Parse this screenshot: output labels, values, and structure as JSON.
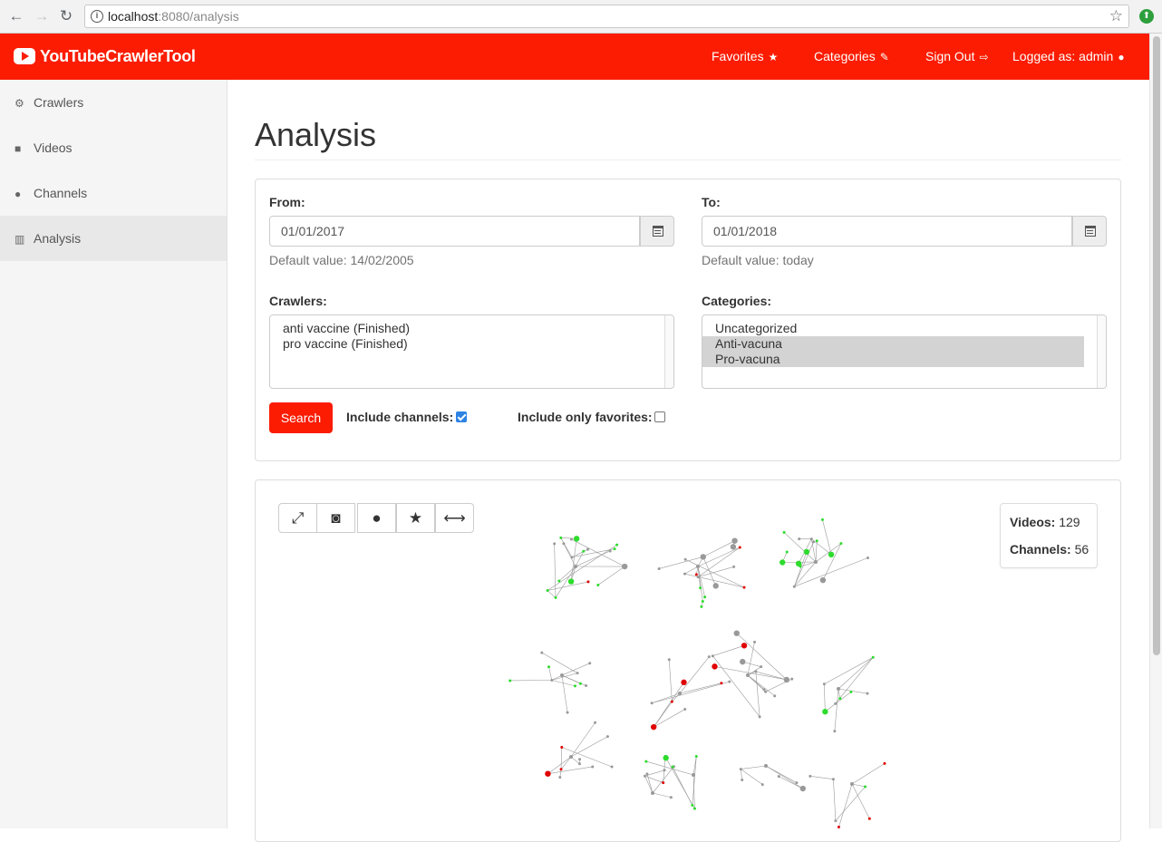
{
  "browser": {
    "url_host": "localhost",
    "url_rest": ":8080/analysis"
  },
  "navbar": {
    "brand": "YouTubeCrawlerTool",
    "links": [
      {
        "label": "Favorites",
        "icon": "star-icon"
      },
      {
        "label": "Categories",
        "icon": "edit-icon"
      },
      {
        "label": "Sign Out",
        "icon": "sign-out-icon"
      },
      {
        "label": "Logged as: admin",
        "icon": "user-icon"
      }
    ]
  },
  "sidebar": {
    "items": [
      {
        "label": "Crawlers",
        "icon": "gears-icon"
      },
      {
        "label": "Videos",
        "icon": "video-camera-icon"
      },
      {
        "label": "Channels",
        "icon": "users-icon"
      },
      {
        "label": "Analysis",
        "icon": "bar-chart-icon",
        "active": true
      }
    ]
  },
  "page": {
    "title": "Analysis"
  },
  "form": {
    "from_label": "From:",
    "from_value": "01/01/2017",
    "from_help": "Default value: 14/02/2005",
    "to_label": "To:",
    "to_value": "01/01/2018",
    "to_help": "Default value: today",
    "crawlers_label": "Crawlers:",
    "crawlers": [
      "anti vaccine (Finished)",
      "pro vaccine (Finished)"
    ],
    "categories_label": "Categories:",
    "categories": [
      {
        "label": "Uncategorized",
        "selected": false
      },
      {
        "label": "Anti-vacuna",
        "selected": true
      },
      {
        "label": "Pro-vacuna",
        "selected": true
      }
    ],
    "search_label": "Search",
    "include_channels_label": "Include channels:",
    "include_channels": true,
    "only_favorites_label": "Include only favorites:",
    "only_favorites": false
  },
  "graph": {
    "tools": [
      "expand-icon",
      "camera-icon",
      "circle-icon",
      "star-icon",
      "arrows-horizontal-icon"
    ],
    "videos_label": "Videos:",
    "videos_count": "129",
    "channels_label": "Channels:",
    "channels_count": "56",
    "colors": {
      "anti": "#e00000",
      "pro": "#2ddc2d",
      "neutral": "#999999",
      "edge": "#9a9a9a"
    }
  }
}
